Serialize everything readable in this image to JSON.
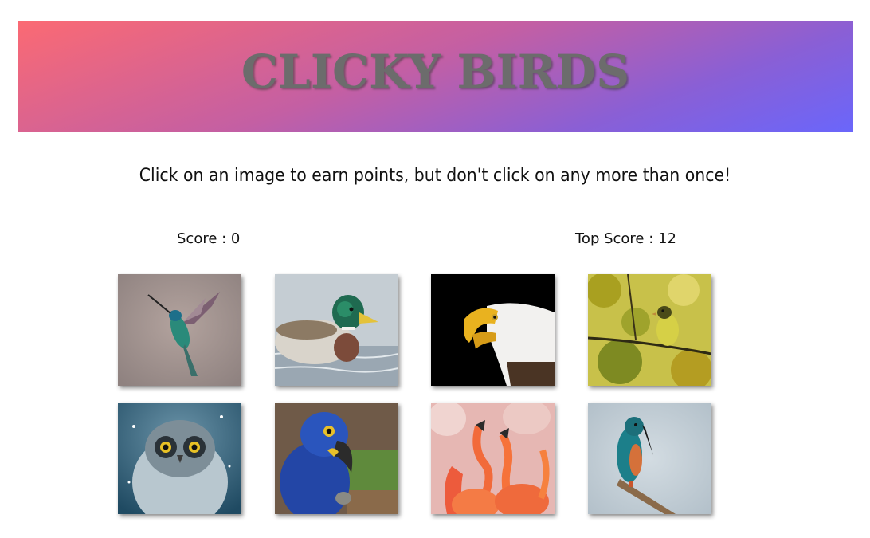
{
  "header": {
    "title": "CLICKY BIRDS"
  },
  "instructions": "Click on an image to earn points, but don't click on any more than once!",
  "scoreboard": {
    "score_label": "Score : 0",
    "top_score_label": "Top Score : 12"
  },
  "colors": {
    "gradient_start": "#fb6a73",
    "gradient_end": "#6a66fb",
    "title": "#6c6c6c"
  },
  "birds": [
    {
      "icon": "hummingbird-image"
    },
    {
      "icon": "mallard-duck-image"
    },
    {
      "icon": "bald-eagle-image"
    },
    {
      "icon": "finch-image"
    },
    {
      "icon": "snowy-owl-image"
    },
    {
      "icon": "macaw-image"
    },
    {
      "icon": "flamingo-image"
    },
    {
      "icon": "kingfisher-image"
    }
  ]
}
